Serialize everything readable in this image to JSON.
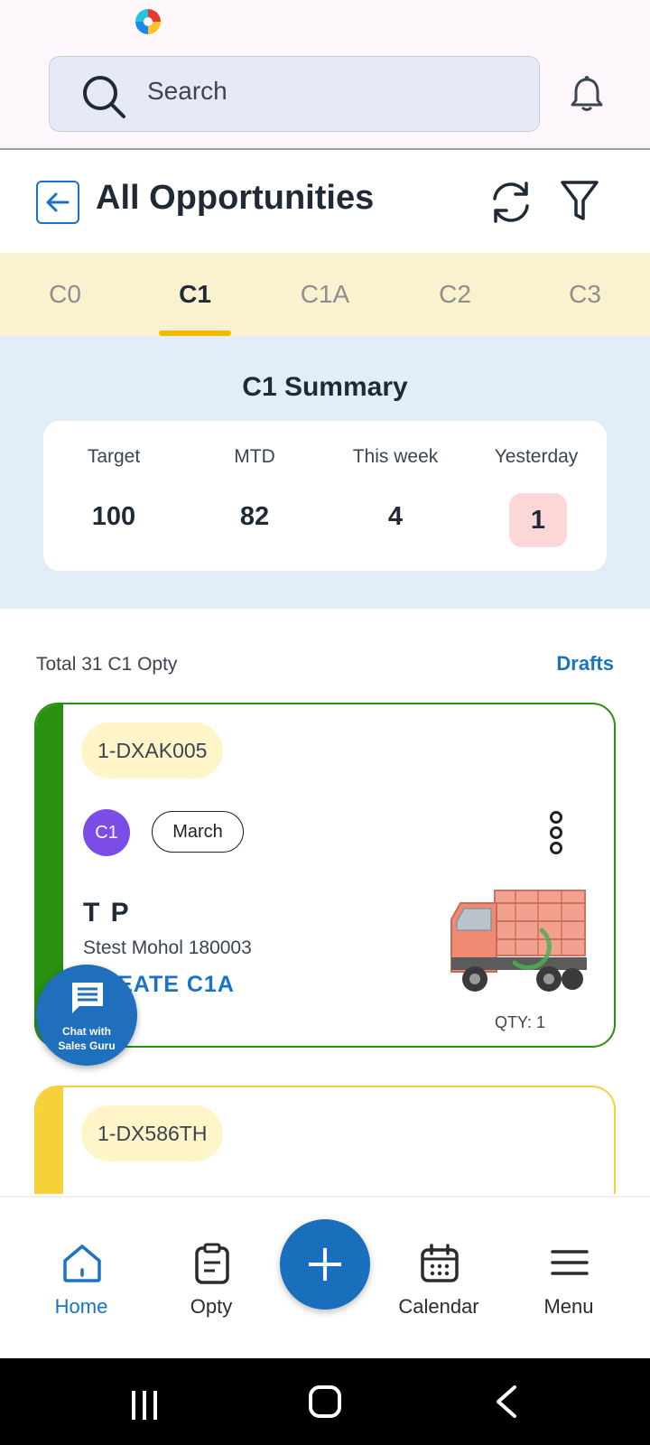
{
  "search": {
    "placeholder": "Search"
  },
  "header": {
    "title": "All Opportunities"
  },
  "tabs": [
    {
      "label": "C0"
    },
    {
      "label": "C1"
    },
    {
      "label": "C1A"
    },
    {
      "label": "C2"
    },
    {
      "label": "C3"
    }
  ],
  "active_tab": "C1",
  "summary": {
    "title": "C1 Summary",
    "stats": [
      {
        "label": "Target",
        "value": "100"
      },
      {
        "label": "MTD",
        "value": "82"
      },
      {
        "label": "This week",
        "value": "4"
      },
      {
        "label": "Yesterday",
        "value": "1"
      }
    ]
  },
  "list": {
    "total_text": "Total 31 C1 Opty",
    "drafts_label": "Drafts"
  },
  "cards": [
    {
      "opty_id": "1-DXAK005",
      "stage": "C1",
      "month": "March",
      "customer_name": "T P",
      "location": "Stest Mohol  180003",
      "action": "CREATE C1A",
      "qty": "QTY: 1",
      "accent": "#2a9010"
    },
    {
      "opty_id": "1-DX586TH",
      "accent": "#f7d13a"
    }
  ],
  "chat": {
    "line1": "Chat with",
    "line2": "Sales Guru"
  },
  "bottom_nav": {
    "home": "Home",
    "opty": "Opty",
    "calendar": "Calendar",
    "menu": "Menu"
  },
  "colors": {
    "primary": "#1a73c4",
    "tab_bg": "#faf1cf",
    "summary_bg": "#e1eef9",
    "yesterday_pill": "#fbd7d7",
    "stage_badge": "#7b4de6"
  }
}
